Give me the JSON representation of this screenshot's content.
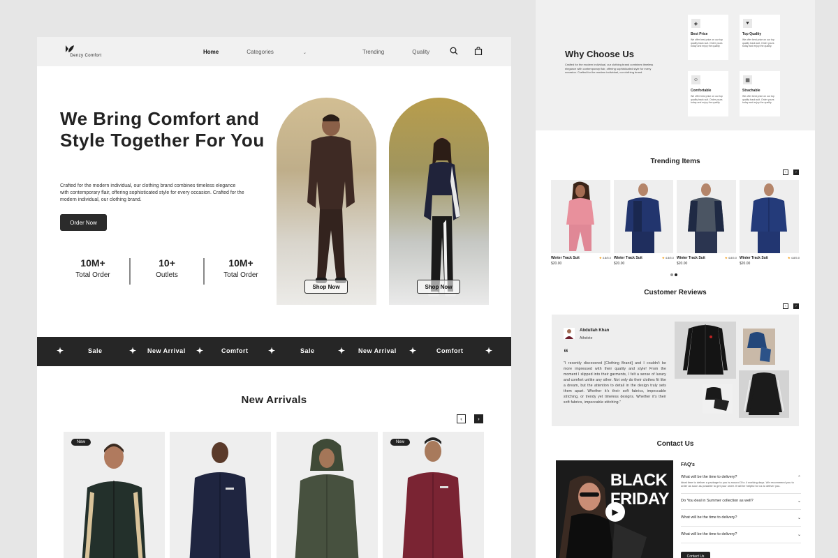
{
  "brand": {
    "name": "Denzy Comfort"
  },
  "nav": {
    "home": "Home",
    "categories": "Categories",
    "trending": "Trending",
    "quality": "Quality"
  },
  "hero": {
    "title": "We Bring Comfort and Style Together For You",
    "description": "Crafted for the modern individual, our clothing brand combines timeless elegance with contemporary flair, offering sophisticated style for every occasion. Crafted for the modern individual, our clothing brand.",
    "cta": "Order Now",
    "stats": [
      {
        "value": "10M+",
        "label": "Total Order"
      },
      {
        "value": "10+",
        "label": "Outlets"
      },
      {
        "value": "10M+",
        "label": "Total Order"
      }
    ],
    "shop_now_1": "Shop Now",
    "shop_now_2": "Shop Now"
  },
  "marquee": [
    "Sale",
    "New Arrival",
    "Comfort",
    "Sale",
    "New Arrival",
    "Comfort"
  ],
  "new_arrivals": {
    "title": "New Arrivals",
    "badges": [
      "New",
      "New"
    ]
  },
  "why": {
    "title": "Why Choose Us",
    "description": "Crafted for the modern individual, our clothing brand combines timeless elegance with contemporary flair, offering sophisticated style for every occasion. Crafted for the modern individual, our clothing brand.",
    "features": [
      {
        "title": "Best Price",
        "desc": "We offer best price on our top quality track suit. Order yours today and enjoy the quality."
      },
      {
        "title": "Top Quality",
        "desc": "We offer best price on our top quality track suit. Order yours today and enjoy the quality."
      },
      {
        "title": "Comfortable",
        "desc": "We offer best price on our top quality track suit. Order yours today and enjoy the quality."
      },
      {
        "title": "Strachable",
        "desc": "We offer best price on our top quality track suit. Order yours today and enjoy the quality."
      }
    ]
  },
  "trending": {
    "title": "Trending Items",
    "items": [
      {
        "name": "Winter Track Suit",
        "rating": "4.8/5.0",
        "price": "$20.00",
        "color": "#e8909c"
      },
      {
        "name": "Winter Track Suit",
        "rating": "4.8/5.0",
        "price": "$20.00",
        "color": "#22356e"
      },
      {
        "name": "Winter Track Suit",
        "rating": "4.8/5.0",
        "price": "$20.00",
        "color": "#4b5563"
      },
      {
        "name": "Winter Track Suit",
        "rating": "4.8/5.0",
        "price": "$20.00",
        "color": "#243b7a"
      }
    ]
  },
  "reviews": {
    "title": "Customer Reviews",
    "name": "Abdullah Khan",
    "role": "Athelete",
    "text": "\"I recently discovered [Clothing Brand] and I couldn't be more impressed with their quality and style! From the moment I slipped into their garments, I felt a sense of luxury and comfort unlike any other. Not only do their clothes fit like a dream, but the attention to detail in the design truly sets them apart. Whether it's their soft fabrics, impeccable stitching, or trendy yet timeless designs. Whether it's their soft fabrics, impeccable stitching.\""
  },
  "contact": {
    "title": "Contact Us",
    "video_text_1": "BLACK",
    "video_text_2": "FRIDAY",
    "faq_title": "FAQ's",
    "faqs": [
      {
        "q": "What will be the time to delivery?",
        "a": "Ideal time to deliver a package to you is around 3 to 4 working days. We recommend you to order as soon as possible to get your order. It will be helpful for us to deliver you."
      },
      {
        "q": "Do You deal in Summer collection as well?"
      },
      {
        "q": "What will be the time to delivery?"
      },
      {
        "q": "What will be the time to delivery?"
      }
    ],
    "button": "Contact Us"
  }
}
